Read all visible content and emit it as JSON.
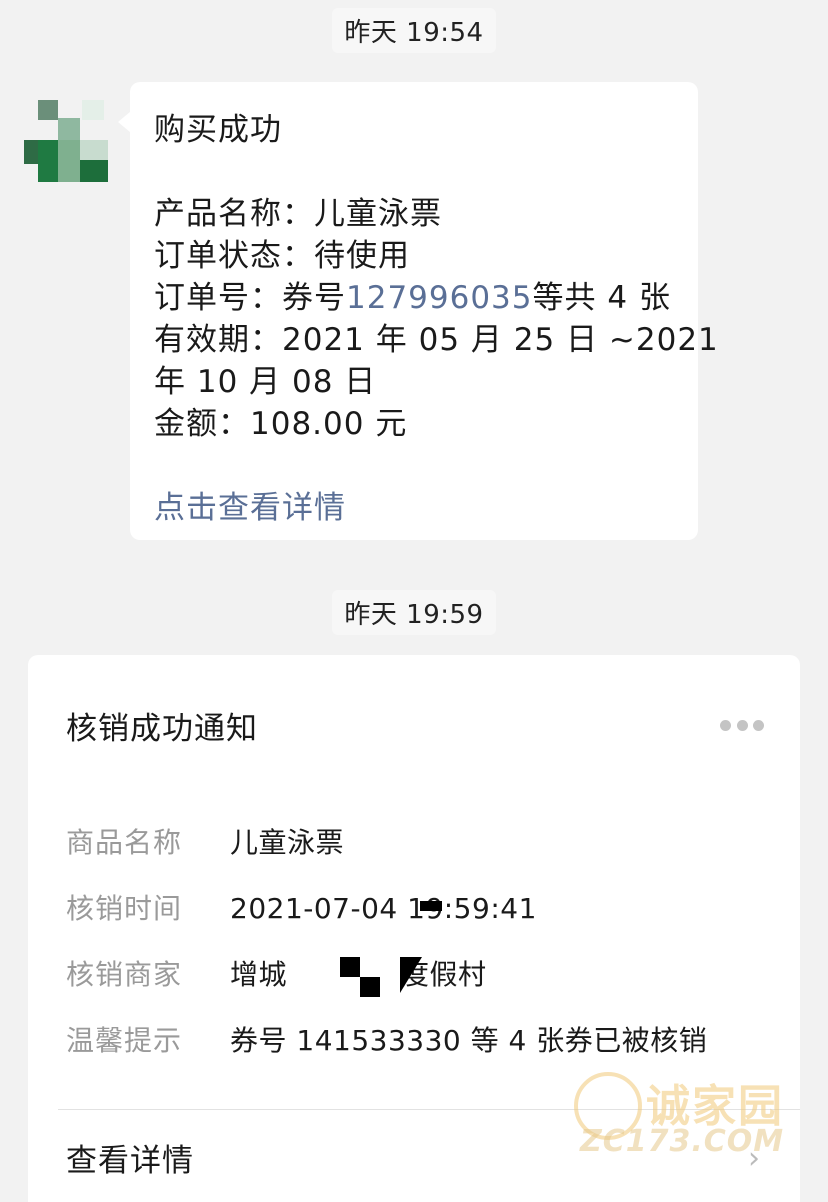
{
  "chat": {
    "timestamp_1": "昨天 19:54",
    "timestamp_2": "昨天 19:59"
  },
  "purchase_message": {
    "title": "购买成功",
    "product_line": "产品名称：儿童泳票",
    "status_line": "订单状态：待使用",
    "order_prefix": "订单号：券号",
    "order_number": "127996035",
    "order_suffix": "等共 4 张",
    "validity_line_1": "有效期：2021 年 05 月 25 日 ~2021",
    "validity_line_2": "年 10 月 08 日",
    "amount_line": "金额：108.00 元",
    "detail_link": "点击查看详情"
  },
  "redeem_card": {
    "title": "核销成功通知",
    "fields": [
      {
        "label": "商品名称",
        "value": "儿童泳票"
      },
      {
        "label": "核销时间",
        "value": "2021-07-04 19:59:41"
      },
      {
        "label": "核销商家",
        "value_left": "增城",
        "value_right": "度假村"
      },
      {
        "label": "温馨提示",
        "value": "券号 141533330 等 4 张券已被核销"
      }
    ],
    "detail_label": "查看详情"
  },
  "watermark": {
    "text": "诚家园",
    "domain": "ZC173.COM"
  },
  "colors": {
    "background": "#f2f2f2",
    "card": "#ffffff",
    "link": "#5a6f96",
    "label_gray": "#9a9a9a"
  },
  "icons": {
    "more": "more-dots-icon",
    "chevron": "chevron-right-icon"
  }
}
